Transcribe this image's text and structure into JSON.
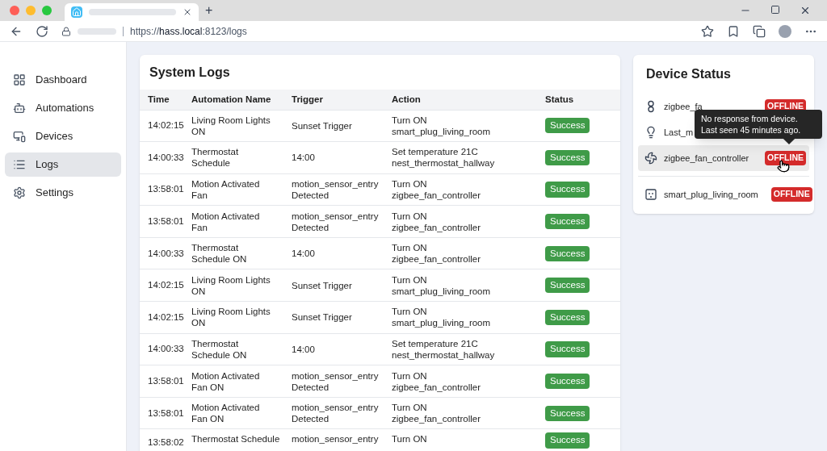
{
  "browser": {
    "url_prefix": "https://",
    "url_host": "hass.local",
    "url_rest": ":8123/logs",
    "new_tab": "+"
  },
  "sidebar": {
    "items": [
      {
        "label": "Dashboard",
        "selected": false
      },
      {
        "label": "Automations",
        "selected": false
      },
      {
        "label": "Devices",
        "selected": false
      },
      {
        "label": "Logs",
        "selected": true
      },
      {
        "label": "Settings",
        "selected": false
      }
    ]
  },
  "logs": {
    "title": "System Logs",
    "columns": [
      "Time",
      "Automation Name",
      "Trigger",
      "Action",
      "Status"
    ],
    "rows": [
      {
        "time": "14:02:15",
        "name": "Living Room Lights ON",
        "trigger": "Sunset Trigger",
        "action": "Turn ON smart_plug_living_room",
        "status": "Success"
      },
      {
        "time": "14:00:33",
        "name": "Thermostat Schedule",
        "trigger": "14:00",
        "action": "Set temperature 21C nest_thermostat_hallway",
        "status": "Success"
      },
      {
        "time": "13:58:01",
        "name": "Motion Activated Fan",
        "trigger": "motion_sensor_entry Detected",
        "action": "Turn ON zigbee_fan_controller",
        "status": "Success"
      },
      {
        "time": "13:58:01",
        "name": "Motion Activated Fan",
        "trigger": "motion_sensor_entry Detected",
        "action": "Turn ON zigbee_fan_controller",
        "status": "Success"
      },
      {
        "time": "14:00:33",
        "name": "Thermostat Schedule ON",
        "trigger": "14:00",
        "action": "Turn ON zigbee_fan_controller",
        "status": "Success"
      },
      {
        "time": "14:02:15",
        "name": "Living Room Lights ON",
        "trigger": "Sunset Trigger",
        "action": "Turn ON smart_plug_living_room",
        "status": "Success"
      },
      {
        "time": "14:02:15",
        "name": "Living Room Lights ON",
        "trigger": "Sunset Trigger",
        "action": "Turn ON smart_plug_living_room",
        "status": "Success"
      },
      {
        "time": "14:00:33",
        "name": "Thermostat Schedule ON",
        "trigger": "14:00",
        "action": "Set temperature 21C nest_thermostat_hallway",
        "status": "Success"
      },
      {
        "time": "13:58:01",
        "name": "Motion Activated Fan ON",
        "trigger": "motion_sensor_entry Detected",
        "action": "Turn ON zigbee_fan_controller",
        "status": "Success"
      },
      {
        "time": "13:58:01",
        "name": "Motion Activated Fan ON",
        "trigger": "motion_sensor_entry Detected",
        "action": "Turn ON zigbee_fan_controller",
        "status": "Success"
      },
      {
        "time": "13:58:02",
        "name": "Thermostat Schedule",
        "trigger": "motion_sensor_entry",
        "action": "Turn ON",
        "status": "Success"
      }
    ]
  },
  "devices": {
    "title": "Device Status",
    "items": [
      {
        "kind": "sensor",
        "name": "zigbee_fa",
        "status": "OFFLINE",
        "selected": false
      },
      {
        "kind": "bulb",
        "name": "Last_m",
        "selected": false
      },
      {
        "kind": "fan",
        "name": "zigbee_fan_controller",
        "status": "OFFLINE",
        "selected": true
      },
      {
        "kind": "plug",
        "name": "smart_plug_living_room",
        "status": "OFFLINE",
        "selected": false
      }
    ],
    "tooltip": "No response from device. Last seen 45 minutes ago."
  }
}
